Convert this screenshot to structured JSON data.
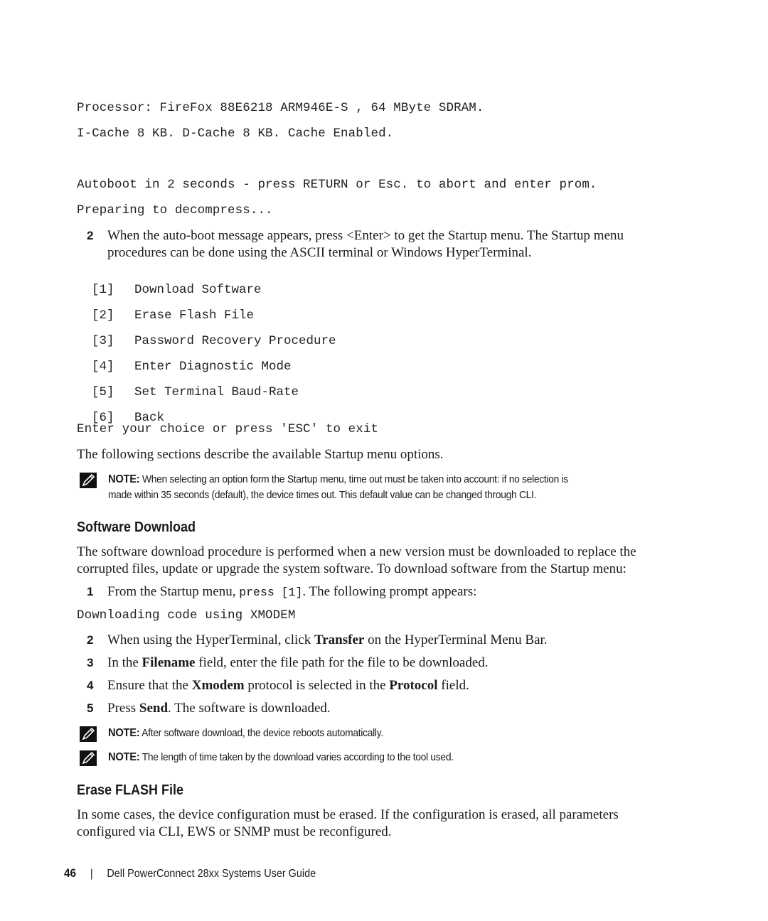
{
  "terminal_output": {
    "line1": "Processor: FireFox 88E6218 ARM946E-S , 64 MByte SDRAM.",
    "line2": "I-Cache 8 KB. D-Cache 8 KB. Cache Enabled.",
    "line3": "Autoboot in 2 seconds - press RETURN or Esc. to abort and enter prom.",
    "line4": "Preparing to decompress..."
  },
  "step2_boot": {
    "number": "2",
    "text_line1": "When the auto-boot message appears, press <Enter> to get the Startup menu. The Startup menu",
    "text_line2": "procedures can be done using the ASCII terminal or Windows HyperTerminal."
  },
  "startup_menu": {
    "items": [
      {
        "index": "[1]",
        "label": "Download Software"
      },
      {
        "index": "[2]",
        "label": "Erase Flash File"
      },
      {
        "index": "[3]",
        "label": "Password Recovery Procedure"
      },
      {
        "index": "[4]",
        "label": "Enter Diagnostic Mode"
      },
      {
        "index": "[5]",
        "label": "Set Terminal Baud-Rate"
      },
      {
        "index": "[6]",
        "label": "Back"
      }
    ],
    "prompt": "Enter your choice or press 'ESC' to exit"
  },
  "intro_text": "The following sections describe the available Startup menu options.",
  "note_timeout": {
    "label": "NOTE:",
    "line1": " When selecting an option form the Startup menu, time out must be taken into account: if no selection is",
    "line2": "made within 35 seconds (default), the device times out. This default value can be changed through CLI."
  },
  "software_download": {
    "heading": "Software Download",
    "para_line1": "The software download procedure is performed when a new version must be downloaded to replace the",
    "para_line2": "corrupted files, update or upgrade the system software. To download software from the Startup menu:",
    "step1": {
      "number": "1",
      "pre": "From the Startup menu, ",
      "code": "press [1]",
      "post": ". The following prompt appears:"
    },
    "prompt_output": "Downloading code using XMODEM",
    "step2": {
      "number": "2",
      "pre": "When using the HyperTerminal, click ",
      "bold": "Transfer",
      "post": " on the HyperTerminal Menu Bar."
    },
    "step3": {
      "number": "3",
      "pre": "In the ",
      "bold": "Filename",
      "post": " field, enter the file path for the file to be downloaded."
    },
    "step4": {
      "number": "4",
      "pre": "Ensure that the ",
      "bold1": "Xmodem",
      "mid": " protocol is selected in the ",
      "bold2": "Protocol",
      "post": " field."
    },
    "step5": {
      "number": "5",
      "pre": "Press ",
      "bold": "Send",
      "post": ". The software is downloaded."
    },
    "note_reboot": {
      "label": "NOTE:",
      "text": " After software download, the device reboots automatically."
    },
    "note_length": {
      "label": "NOTE:",
      "text": " The length of time taken by the download varies according to the tool used."
    }
  },
  "erase_flash": {
    "heading": "Erase FLASH File",
    "para_line1": "In some cases, the device configuration must be erased. If the configuration is erased, all parameters",
    "para_line2": "configured via CLI, EWS or SNMP must be reconfigured."
  },
  "footer": {
    "page_number": "46",
    "separator": "|",
    "title": "Dell PowerConnect 28xx Systems User Guide"
  }
}
